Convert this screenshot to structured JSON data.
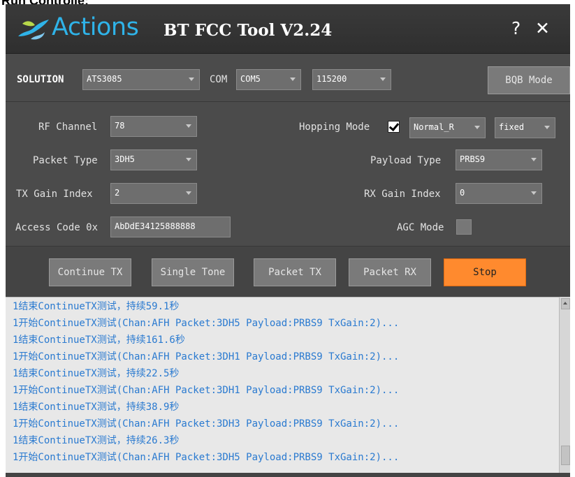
{
  "page_heading": "Run Controlle:",
  "window": {
    "brand": "Actions",
    "title": "BT FCC Tool V2.24",
    "help_label": "?",
    "close_label": "✕"
  },
  "solution": {
    "label": "SOLUTION",
    "value": "ATS3085",
    "com_label": "COM",
    "com_value": "COM5",
    "baud_value": "115200",
    "bqb_button": "BQB Mode"
  },
  "params": {
    "rf_channel_label": "RF Channel",
    "rf_channel_value": "78",
    "hopping_mode_label": "Hopping Mode",
    "hopping_checked": true,
    "hopping_type_value": "Normal_R",
    "hopping_fixed_value": "fixed",
    "packet_type_label": "Packet Type",
    "packet_type_value": "3DH5",
    "payload_type_label": "Payload Type",
    "payload_type_value": "PRBS9",
    "tx_gain_label": "TX Gain Index",
    "tx_gain_value": "2",
    "rx_gain_label": "RX Gain Index",
    "rx_gain_value": "0",
    "access_code_label": "Access Code 0x",
    "access_code_value": "AbDdE34125888888",
    "agc_label": "AGC Mode"
  },
  "actions": {
    "continue_tx": "Continue TX",
    "single_tone": "Single Tone",
    "packet_tx": "Packet TX",
    "packet_rx": "Packet RX",
    "stop": "Stop"
  },
  "log": [
    "1结束ContinueTX测试，持续59.1秒",
    "1开始ContinueTX测试(Chan:AFH Packet:3DH5 Payload:PRBS9 TxGain:2)...",
    "1结束ContinueTX测试，持续161.6秒",
    "1开始ContinueTX测试(Chan:AFH Packet:3DH1 Payload:PRBS9 TxGain:2)...",
    "1结束ContinueTX测试，持续22.5秒",
    "1开始ContinueTX测试(Chan:AFH Packet:3DH1 Payload:PRBS9 TxGain:2)...",
    "1结束ContinueTX测试，持续38.9秒",
    "1开始ContinueTX测试(Chan:AFH Packet:3DH3 Payload:PRBS9 TxGain:2)...",
    "1结束ContinueTX测试，持续26.3秒",
    "1开始ContinueTX测试(Chan:AFH Packet:3DH5 Payload:PRBS9 TxGain:2)..."
  ],
  "colors": {
    "brand": "#2fb3e8",
    "stop_button": "#ff8a2e",
    "log_text": "#2a7ad0"
  }
}
